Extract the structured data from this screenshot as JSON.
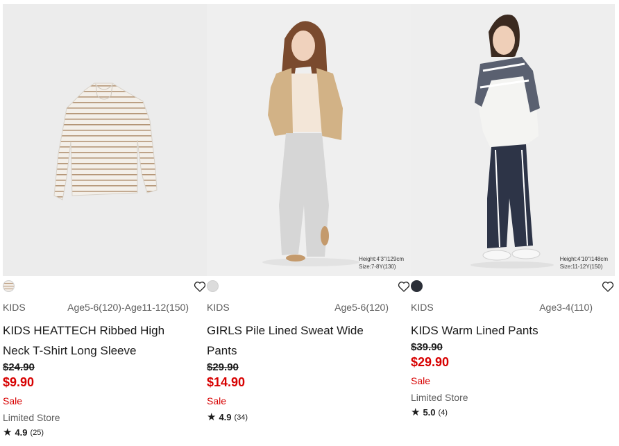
{
  "products": [
    {
      "swatch_color": "#f1ece6",
      "swatch_stripe": "#b9987a",
      "category": "KIDS",
      "size_range": "Age5-6(120)-Age11-12(150)",
      "name_line1": "KIDS HEATTECH Ribbed High",
      "name_line2": "Neck T-Shirt Long Sleeve",
      "old_price": "$24.90",
      "new_price": "$9.90",
      "sale": "Sale",
      "store": "Limited Store",
      "rating": "4.9",
      "reviews": "(25)",
      "size_note_1": "",
      "size_note_2": ""
    },
    {
      "swatch_color": "#dcdcdc",
      "category": "KIDS",
      "size_range": "Age5-6(120)",
      "name_line1": "GIRLS Pile Lined Sweat Wide Pants",
      "name_line2": "",
      "old_price": "$29.90",
      "new_price": "$14.90",
      "sale": "Sale",
      "store": "",
      "rating": "4.9",
      "reviews": "(34)",
      "size_note_1": "Height:4'3\"/129cm",
      "size_note_2": "Size:7-8Y(130)"
    },
    {
      "swatch_color": "#2b2f38",
      "category": "KIDS",
      "size_range": "Age3-4(110)",
      "name_line1": "KIDS Warm Lined Pants",
      "name_line2": "",
      "old_price": "$39.90",
      "new_price": "$29.90",
      "sale": "Sale",
      "store": "Limited Store",
      "rating": "5.0",
      "reviews": "(4)",
      "size_note_1": "Height:4'10\"/148cm",
      "size_note_2": "Size:11-12Y(150)"
    }
  ],
  "icons": {
    "favorite": "heart-outline-icon",
    "rating": "star-icon"
  },
  "colors": {
    "sale_red": "#d70000",
    "text": "#1b1b1b",
    "muted": "#5d5d5d"
  }
}
